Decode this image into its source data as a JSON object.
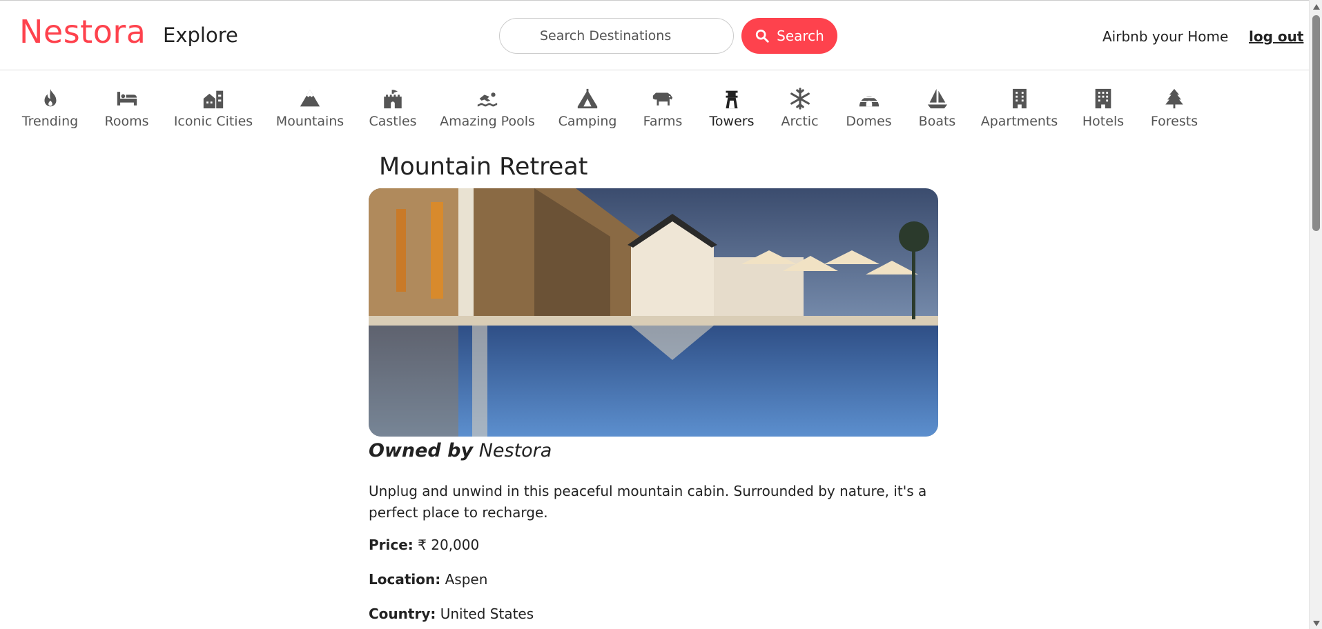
{
  "navbar": {
    "brand": "Nestora",
    "explore": "Explore",
    "search_placeholder": "Search Destinations",
    "search_button": "Search",
    "host_link": "Airbnb your Home",
    "logout_link": "log out"
  },
  "filters": [
    {
      "label": "Trending",
      "icon": "fire-icon"
    },
    {
      "label": "Rooms",
      "icon": "bed-icon"
    },
    {
      "label": "Iconic Cities",
      "icon": "city-icon"
    },
    {
      "label": "Mountains",
      "icon": "mountain-icon"
    },
    {
      "label": "Castles",
      "icon": "castle-icon"
    },
    {
      "label": "Amazing Pools",
      "icon": "swimmer-icon"
    },
    {
      "label": "Camping",
      "icon": "tent-icon"
    },
    {
      "label": "Farms",
      "icon": "cow-icon"
    },
    {
      "label": "Towers",
      "icon": "tower-icon"
    },
    {
      "label": "Arctic",
      "icon": "snowflake-icon"
    },
    {
      "label": "Domes",
      "icon": "igloo-icon"
    },
    {
      "label": "Boats",
      "icon": "sailboat-icon"
    },
    {
      "label": "Apartments",
      "icon": "building-icon"
    },
    {
      "label": "Hotels",
      "icon": "hotel-icon"
    },
    {
      "label": "Forests",
      "icon": "tree-icon"
    }
  ],
  "listing": {
    "title": "Mountain Retreat",
    "owned_by_label": "Owned by",
    "owner": "Nestora",
    "description": "Unplug and unwind in this peaceful mountain cabin. Surrounded by nature, it's a perfect place to recharge.",
    "price_label": "Price:",
    "price": "₹ 20,000",
    "location_label": "Location:",
    "location": "Aspen",
    "country_label": "Country:",
    "country": "United States"
  },
  "colors": {
    "brand": "#fe424d",
    "text": "#222222",
    "muted": "#555555"
  }
}
